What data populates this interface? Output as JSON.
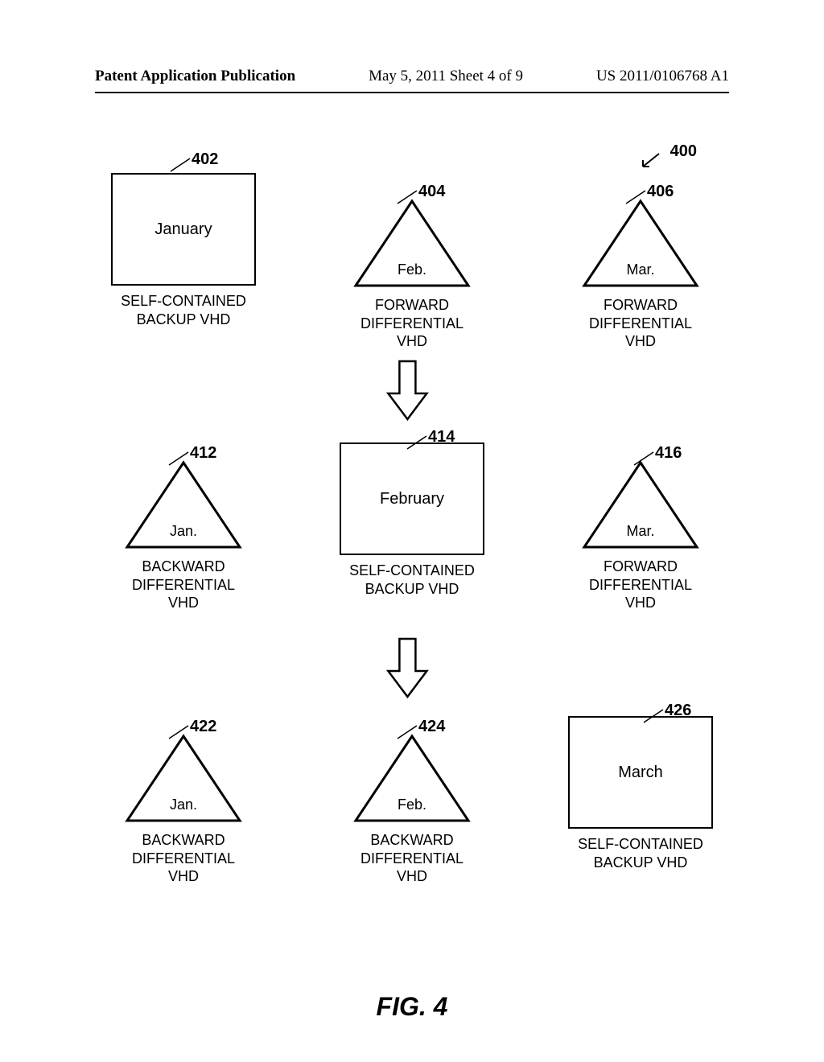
{
  "header": {
    "left": "Patent Application Publication",
    "mid": "May 5, 2011  Sheet 4 of 9",
    "right": "US 2011/0106768 A1"
  },
  "figure": {
    "overall_ref": "400",
    "title": "FIG. 4",
    "rows": [
      {
        "cells": [
          {
            "ref": "402",
            "shape": "rect",
            "inner": "January",
            "caption": "SELF-CONTAINED\nBACKUP VHD"
          },
          {
            "ref": "404",
            "shape": "tri",
            "inner": "Feb.",
            "caption": "FORWARD\nDIFFERENTIAL\nVHD"
          },
          {
            "ref": "406",
            "shape": "tri",
            "inner": "Mar.",
            "caption": "FORWARD\nDIFFERENTIAL\nVHD"
          }
        ]
      },
      {
        "cells": [
          {
            "ref": "412",
            "shape": "tri",
            "inner": "Jan.",
            "caption": "BACKWARD\nDIFFERENTIAL\nVHD"
          },
          {
            "ref": "414",
            "shape": "rect",
            "inner": "February",
            "caption": "SELF-CONTAINED\nBACKUP VHD"
          },
          {
            "ref": "416",
            "shape": "tri",
            "inner": "Mar.",
            "caption": "FORWARD\nDIFFERENTIAL\nVHD"
          }
        ]
      },
      {
        "cells": [
          {
            "ref": "422",
            "shape": "tri",
            "inner": "Jan.",
            "caption": "BACKWARD\nDIFFERENTIAL\nVHD"
          },
          {
            "ref": "424",
            "shape": "tri",
            "inner": "Feb.",
            "caption": "BACKWARD\nDIFFERENTIAL\nVHD"
          },
          {
            "ref": "426",
            "shape": "rect",
            "inner": "March",
            "caption": "SELF-CONTAINED\nBACKUP VHD"
          }
        ]
      }
    ]
  }
}
